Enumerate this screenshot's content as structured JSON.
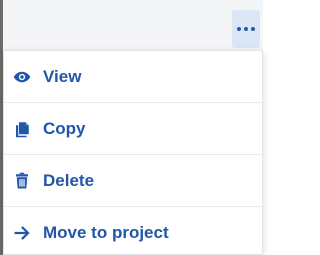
{
  "colors": {
    "accent": "#2157a8",
    "button_bg": "#dbe7f6",
    "topbar_bg": "#f4f5f7"
  },
  "more_button": {
    "icon": "more-horizontal-icon"
  },
  "menu": {
    "items": [
      {
        "label": "View",
        "icon": "eye-icon"
      },
      {
        "label": "Copy",
        "icon": "copy-icon"
      },
      {
        "label": "Delete",
        "icon": "trash-icon"
      },
      {
        "label": "Move to project",
        "icon": "arrow-right-icon"
      }
    ]
  }
}
